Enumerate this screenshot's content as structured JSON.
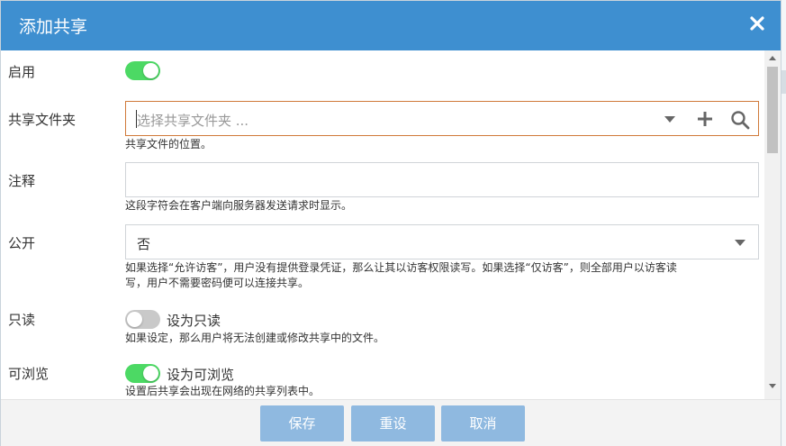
{
  "dialog": {
    "title": "添加共享"
  },
  "fields": {
    "enable": {
      "label": "启用",
      "on": true
    },
    "share_folder": {
      "label": "共享文件夹",
      "placeholder": "选择共享文件夹 ...",
      "help": "共享文件的位置。"
    },
    "comment": {
      "label": "注释",
      "value": "",
      "help": "这段字符会在客户端向服务器发送请求时显示。"
    },
    "public": {
      "label": "公开",
      "value": "否",
      "help_line1": "如果选择“允许访客”，用户没有提供登录凭证，那么让其以访客权限读写。如果选择“仅访客”，则全部用户以访客读",
      "help_line2": "写，用户不需要密码便可以连接共享。"
    },
    "readonly": {
      "label": "只读",
      "on": false,
      "toggle_text": "设为只读",
      "help": "如果设定，那么用户将无法创建或修改共享中的文件。"
    },
    "browsable": {
      "label": "可浏览",
      "on": true,
      "toggle_text": "设为可浏览",
      "help": "设置后共享会出现在网络的共享列表中。"
    }
  },
  "footer": {
    "save_label": "保存",
    "reset_label": "重设",
    "cancel_label": "取消"
  },
  "colors": {
    "header": "#3e8fd0",
    "toggle_on": "#4cd964",
    "toggle_off": "#c9c9c9",
    "button": "#8fb9e0",
    "focus_border": "#d07a3a"
  },
  "icons": {
    "close": "close-icon",
    "dropdown": "chevron-down-icon",
    "add": "plus-icon",
    "search": "search-icon"
  }
}
